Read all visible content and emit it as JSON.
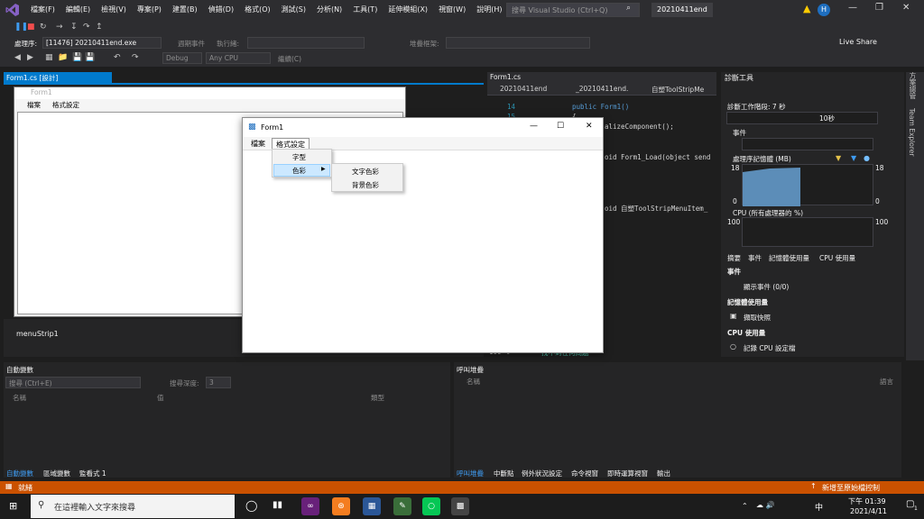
{
  "vs": {
    "menu": [
      "檔案(F)",
      "編輯(E)",
      "檢視(V)",
      "專案(P)",
      "建置(B)",
      "偵錯(D)",
      "格式(O)",
      "測試(S)",
      "分析(N)",
      "工具(T)",
      "延伸模組(X)",
      "視窗(W)",
      "說明(H)"
    ],
    "search_placeholder": "搜尋 Visual Studio (Ctrl+Q)",
    "solution_name": "20210411end",
    "avatar_initial": "H",
    "live_share": "Live Share",
    "process_label": "處理序:",
    "process_value": "[11476] 20210411end.exe",
    "lifecycle_label": "週期事件",
    "thread_label": "執行緒:",
    "stackframe_label": "堆疊框架:",
    "config": "Debug",
    "platform": "Any CPU",
    "continue_label": "繼續(C)"
  },
  "designer": {
    "tab_label": "Form1.cs [設計]",
    "form_title": "Form1",
    "menu": [
      "檔案",
      "格式設定"
    ],
    "component": "menuStrip1"
  },
  "code": {
    "tab_label": "Form1.cs",
    "nav_project": "20210411end",
    "nav_class": "_20210411end.",
    "nav_member": "自塑ToolStripMe",
    "line_numbers": [
      "14",
      "15",
      "16"
    ],
    "lines": [
      "public Form1()",
      "{",
      "alizeComponent();",
      "oid Form1_Load(object send",
      "oid 自塑ToolStripMenuItem_"
    ],
    "zoom": "100 %",
    "status": "找不到任何問題"
  },
  "diagnostics": {
    "title": "診斷工具",
    "session": "診斷工作階段: 7 秒",
    "time_label": "10秒",
    "events": "事件",
    "memory": "處理序記憶體 (MB)",
    "mem_max": "18",
    "mem_min": "0",
    "cpu": "CPU (所有處理器的 %)",
    "cpu_max": "100",
    "tabs": [
      "摘要",
      "事件",
      "記憶體使用量",
      "CPU 使用量"
    ],
    "section_events": "事件",
    "show_events": "顯示事件 (0/0)",
    "section_memory": "記憶體使用量",
    "snapshot": "擷取快照",
    "section_cpu": "CPU 使用量",
    "record_cpu": "記錄 CPU 設定檔"
  },
  "side_tabs": [
    "方案總管",
    "Team Explorer"
  ],
  "autos": {
    "title": "自動變數",
    "search_placeholder": "搜尋 (Ctrl+E)",
    "depth_label": "搜尋深度:",
    "depth_value": "3",
    "columns": [
      "名稱",
      "值",
      "類型"
    ],
    "tabs": [
      "自動變數",
      "區域變數",
      "監看式 1"
    ]
  },
  "callstack": {
    "title": "呼叫堆疊",
    "columns": [
      "名稱",
      "語言"
    ],
    "tabs": [
      "呼叫堆疊",
      "中斷點",
      "例外狀況設定",
      "命令視窗",
      "即時運算視窗",
      "輸出"
    ]
  },
  "status": {
    "ready": "就緒",
    "source_control": "新增至原始檔控制"
  },
  "taskbar": {
    "search_placeholder": "在這裡輸入文字來搜尋",
    "ime": "中",
    "time": "下午 01:39",
    "date": "2021/4/11",
    "notifications": "1"
  },
  "running_form": {
    "title": "Form1",
    "menu": [
      "檔案",
      "格式設定"
    ],
    "format_items": [
      "字型",
      "色彩"
    ],
    "color_items": [
      "文字色彩",
      "背景色彩"
    ]
  },
  "colors": {
    "accent": "#007acc",
    "status_bar": "#ca5100",
    "menu_highlight": "#cce8ff"
  }
}
